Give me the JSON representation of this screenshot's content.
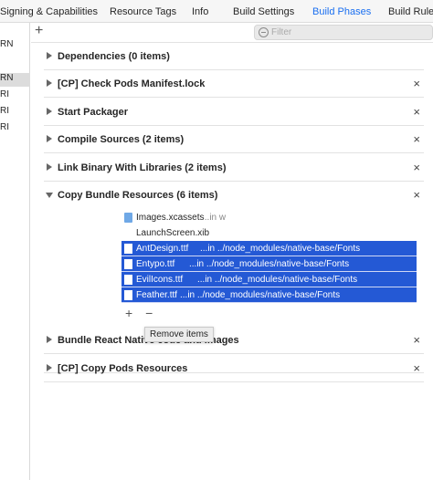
{
  "tabs": [
    {
      "label": "Signing & Capabilities"
    },
    {
      "label": "Resource Tags"
    },
    {
      "label": "Info"
    },
    {
      "label": "Build Settings"
    },
    {
      "label": "Build Phases"
    },
    {
      "label": "Build Rules"
    }
  ],
  "sidebar": {
    "items": [
      {
        "label": "RN"
      },
      {
        "label": "RN"
      },
      {
        "label": "RI"
      },
      {
        "label": "RI"
      },
      {
        "label": "RI"
      }
    ]
  },
  "toolbar": {
    "add_label": "+",
    "filter_placeholder": "Filter"
  },
  "phases": [
    {
      "title": "Dependencies (0 items)"
    },
    {
      "title": "[CP] Check Pods Manifest.lock"
    },
    {
      "title": "Start Packager"
    },
    {
      "title": "Compile Sources (2 items)"
    },
    {
      "title": "Link Binary With Libraries (2 items)"
    },
    {
      "title": "Copy Bundle Resources (6 items)"
    },
    {
      "title": "Bundle React Native code and images"
    },
    {
      "title": "[CP] Copy Pods Resources"
    }
  ],
  "remove_label": "×",
  "files": [
    {
      "name": "Images.xcassets",
      "path": "...in w",
      "icon": "folder-icon"
    },
    {
      "name": "LaunchScreen.xib",
      "path": "",
      "icon": "xib-icon"
    },
    {
      "name": "AntDesign.ttf",
      "path": "...in ../node_modules/native-base/Fonts",
      "icon": "file-icon"
    },
    {
      "name": "Entypo.ttf",
      "path": "...in ../node_modules/native-base/Fonts",
      "icon": "file-icon"
    },
    {
      "name": "EvilIcons.ttf",
      "path": "...in ../node_modules/native-base/Fonts",
      "icon": "file-icon"
    },
    {
      "name": "Feather.ttf",
      "path": "...in ../node_modules/native-base/Fonts",
      "icon": "file-icon"
    }
  ],
  "list_buttons": {
    "add": "+",
    "remove": "−"
  },
  "tooltip": "Remove items",
  "colors": {
    "accent": "#1a6ff0",
    "selection": "#2459d5"
  }
}
